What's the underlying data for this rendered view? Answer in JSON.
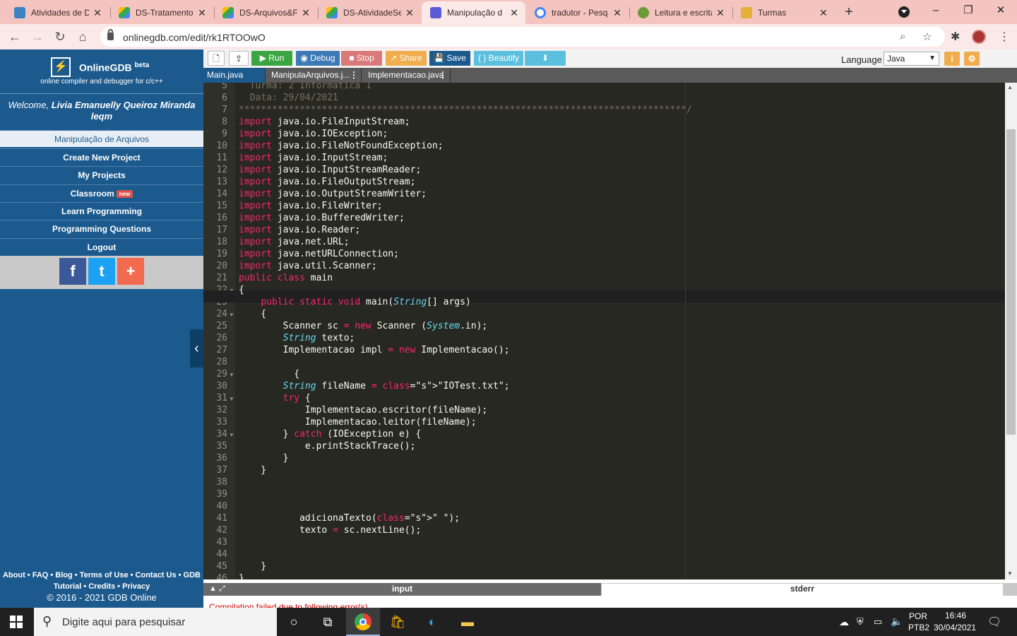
{
  "browser": {
    "tabs": [
      {
        "title": "Atividades de D",
        "color": "#3b82c4"
      },
      {
        "title": "DS-Tratamentol",
        "color": "#34a853"
      },
      {
        "title": "DS-Arquivos&F",
        "color": "#34a853"
      },
      {
        "title": "DS-AtividadeSe",
        "color": "#34a853"
      },
      {
        "title": "Manipulação d",
        "color": "#5b5bd6"
      },
      {
        "title": "tradutor - Pesq",
        "color": "#4285f4"
      },
      {
        "title": "Leitura e escrita",
        "color": "#6b9b37"
      },
      {
        "title": "Turmas",
        "color": "#e3b13a"
      }
    ],
    "new_tab": "+",
    "url": "onlinegdb.com/edit/rk1RTOOwO",
    "window_controls": {
      "minimize": "–",
      "maximize": "❐",
      "close": "✕"
    }
  },
  "app": {
    "logo_title": "OnlineGDB",
    "logo_sup": "beta",
    "logo_sub": "online compiler and debugger for c/c++",
    "welcome_prefix": "Welcome, ",
    "welcome_name": "Livia Emanuelly Queiroz Miranda leqm",
    "menu": [
      {
        "label": "Manipulação de Arquivos"
      },
      {
        "label": "Create New Project"
      },
      {
        "label": "My Projects"
      },
      {
        "label": "Classroom",
        "badge": "new"
      },
      {
        "label": "Learn Programming"
      },
      {
        "label": "Programming Questions"
      },
      {
        "label": "Logout"
      }
    ],
    "share": {
      "facebook": "f",
      "twitter": "t",
      "plus": "+"
    },
    "footer_links_1": "About • FAQ • Blog • Terms of Use • Contact Us • GDB",
    "footer_links_2": "Tutorial • Credits • Privacy",
    "footer_copy": "© 2016 - 2021 GDB Online",
    "collapse_icon": "‹"
  },
  "toolbar": {
    "run": "▶ Run",
    "debug": "Debug",
    "stop": "Stop",
    "share": "Share",
    "save": "Save",
    "beautify": "{ } Beautify",
    "download": "⬇",
    "language_label": "Language",
    "language_value": "Java",
    "info": "i",
    "settings": "⚙",
    "colors": {
      "run": "#3aa641",
      "debug": "#3d79b5",
      "stop": "#d9797a",
      "share": "#f0ad4e",
      "save": "#1c5a8e",
      "beautify": "#5bc0de",
      "download": "#5bc0de"
    }
  },
  "file_tabs": [
    {
      "name": "Main.java",
      "active": true
    },
    {
      "name": "ManipulaArquivos.j...",
      "active": false
    },
    {
      "name": "Implementacao.java",
      "active": false
    }
  ],
  "editor": {
    "lines": [
      {
        "n": "5",
        "text": "  Turma: 2 Informatica 1"
      },
      {
        "n": "6",
        "text": "  Data: 29/04/2021"
      },
      {
        "n": "7",
        "text": "*********************************************************************************/"
      },
      {
        "n": "8",
        "text": "import java.io.FileInputStream;"
      },
      {
        "n": "9",
        "text": "import java.io.IOException;"
      },
      {
        "n": "10",
        "text": "import java.io.FileNotFoundException;"
      },
      {
        "n": "11",
        "text": "import java.io.InputStream;"
      },
      {
        "n": "12",
        "text": "import java.io.InputStreamReader;"
      },
      {
        "n": "13",
        "text": "import java.io.FileOutputStream;"
      },
      {
        "n": "14",
        "text": "import java.io.OutputStreamWriter;"
      },
      {
        "n": "15",
        "text": "import java.io.FileWriter;"
      },
      {
        "n": "16",
        "text": "import java.io.BufferedWriter;"
      },
      {
        "n": "17",
        "text": "import java.io.Reader;"
      },
      {
        "n": "18",
        "text": "import java.net.URL;"
      },
      {
        "n": "19",
        "text": "import java.netURLConnection;"
      },
      {
        "n": "20",
        "text": "import java.util.Scanner;"
      },
      {
        "n": "21",
        "text": "public class main"
      },
      {
        "n": "22",
        "text": "{"
      },
      {
        "n": "23",
        "text": "    public static void main(String[] args) "
      },
      {
        "n": "24",
        "text": "    {"
      },
      {
        "n": "25",
        "text": "        Scanner sc = new Scanner (System.in);"
      },
      {
        "n": "26",
        "text": "        String texto;"
      },
      {
        "n": "27",
        "text": "        Implementacao impl = new Implementacao();"
      },
      {
        "n": "28",
        "text": ""
      },
      {
        "n": "29",
        "text": "          {"
      },
      {
        "n": "30",
        "text": "        String fileName = \"IOTest.txt\";"
      },
      {
        "n": "31",
        "text": "        try {"
      },
      {
        "n": "32",
        "text": "            Implementacao.escritor(fileName);"
      },
      {
        "n": "33",
        "text": "            Implementacao.leitor(fileName);"
      },
      {
        "n": "34",
        "text": "        } catch (IOException e) {"
      },
      {
        "n": "35",
        "text": "            e.printStackTrace();"
      },
      {
        "n": "36",
        "text": "        }"
      },
      {
        "n": "37",
        "text": "    }"
      },
      {
        "n": "38",
        "text": ""
      },
      {
        "n": "39",
        "text": ""
      },
      {
        "n": "40",
        "text": ""
      },
      {
        "n": "41",
        "text": "           adicionaTexto(\" \");"
      },
      {
        "n": "42",
        "text": "           texto = sc.nextLine();"
      },
      {
        "n": "43",
        "text": ""
      },
      {
        "n": "44",
        "text": ""
      },
      {
        "n": "45",
        "text": "    }"
      },
      {
        "n": "46",
        "text": "}"
      }
    ]
  },
  "io": {
    "tab_input": "input",
    "tab_stderr": "stderr",
    "error_text": "Compilation failed due to following error(s)."
  },
  "taskbar": {
    "search_placeholder": "Digite aqui para pesquisar",
    "lang1": "POR",
    "lang2": "PTB2",
    "time": "16:46",
    "date": "30/04/2021"
  }
}
